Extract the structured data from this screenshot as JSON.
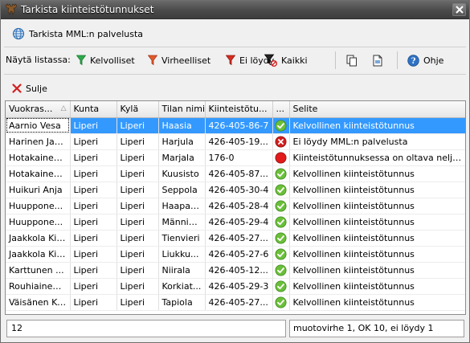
{
  "window": {
    "title": "Tarkista kiinteistötunnukset"
  },
  "toolbar": {
    "check_service_label": "Tarkista MML:n palvelusta",
    "show_in_list_label": "Näytä listassa:",
    "valid_label": "Kelvolliset",
    "invalid_label": "Virheelliset",
    "not_found_label": "Ei löydy",
    "all_label": "Kaikki",
    "help_label": "Ohje",
    "close_label": "Sulje"
  },
  "colors": {
    "valid_filter": "#2eaa4a",
    "invalid_filter": "#e05a2a",
    "not_found_filter": "#d62d20",
    "selection": "#3399ff",
    "ok_status": "#6cbf3a",
    "error_status": "#d21e1e"
  },
  "grid": {
    "columns": [
      "Vuokras...",
      "Kunta",
      "Kylä",
      "Tilan nimi",
      "Kiinteistötu...",
      "...",
      "Selite"
    ],
    "rows": [
      {
        "owner": "Aarnio Vesa",
        "kunta": "Liperi",
        "kyla": "Liperi",
        "tila": "Haasia",
        "tunnus": "426-405-86-7",
        "status": "check-ok-icon",
        "selite": "Kelvollinen kiinteistötunnus",
        "selected": true
      },
      {
        "owner": "Harinen Jaa...",
        "kunta": "Liperi",
        "kyla": "Liperi",
        "tila": "Harjula",
        "tunnus": "426-405-19...",
        "status": "error-x-icon",
        "selite": "Ei löydy MML:n palvelusta",
        "selected": false
      },
      {
        "owner": "Hotakainen...",
        "kunta": "Liperi",
        "kyla": "Liperi",
        "tila": "Marjala",
        "tunnus": "176-0",
        "status": "error-dot-icon",
        "selite": "Kiinteistötunnuksessa on oltava neljä ...",
        "selected": false
      },
      {
        "owner": "Hotakainen...",
        "kunta": "Liperi",
        "kyla": "Liperi",
        "tila": "Kuusisto",
        "tunnus": "426-405-87...",
        "status": "check-ok-icon",
        "selite": "Kelvollinen kiinteistötunnus",
        "selected": false
      },
      {
        "owner": "Huikuri Anja",
        "kunta": "Liperi",
        "kyla": "Liperi",
        "tila": "Seppola",
        "tunnus": "426-405-30-4",
        "status": "check-ok-icon",
        "selite": "Kelvollinen kiinteistötunnus",
        "selected": false
      },
      {
        "owner": "Huuppone...",
        "kunta": "Liperi",
        "kyla": "Liperi",
        "tila": "Haapaoja",
        "tunnus": "426-405-28-4",
        "status": "check-ok-icon",
        "selite": "Kelvollinen kiinteistötunnus",
        "selected": false
      },
      {
        "owner": "Huuppone...",
        "kunta": "Liperi",
        "kyla": "Liperi",
        "tila": "Männistö",
        "tunnus": "426-405-29-4",
        "status": "check-ok-icon",
        "selite": "Kelvollinen kiinteistötunnus",
        "selected": false
      },
      {
        "owner": "Jaakkola Kirsi",
        "kunta": "Liperi",
        "kyla": "Liperi",
        "tila": "Tienvieri",
        "tunnus": "426-405-27...",
        "status": "check-ok-icon",
        "selite": "Kelvollinen kiinteistötunnus",
        "selected": false
      },
      {
        "owner": "Jaakkola Kirsi",
        "kunta": "Liperi",
        "kyla": "Liperi",
        "tila": "Liukku...",
        "tunnus": "426-405-27-6",
        "status": "check-ok-icon",
        "selite": "Kelvollinen kiinteistötunnus",
        "selected": false
      },
      {
        "owner": "Karttunen ...",
        "kunta": "Liperi",
        "kyla": "Liperi",
        "tila": "Niirala",
        "tunnus": "426-405-12...",
        "status": "check-ok-icon",
        "selite": "Kelvollinen kiinteistötunnus",
        "selected": false
      },
      {
        "owner": "Rouhiainen...",
        "kunta": "Liperi",
        "kyla": "Liperi",
        "tila": "Korkiat...",
        "tunnus": "426-405-29-3",
        "status": "check-ok-icon",
        "selite": "Kelvollinen kiinteistötunnus",
        "selected": false
      },
      {
        "owner": "Väisänen Kari",
        "kunta": "Liperi",
        "kyla": "Liperi",
        "tila": "Tapiola",
        "tunnus": "426-405-27...",
        "status": "check-ok-icon",
        "selite": "Kelvollinen kiinteistötunnus",
        "selected": false
      }
    ]
  },
  "statusbar": {
    "count": "12",
    "summary": "muotovirhe 1,  OK 10, ei löydy 1"
  }
}
